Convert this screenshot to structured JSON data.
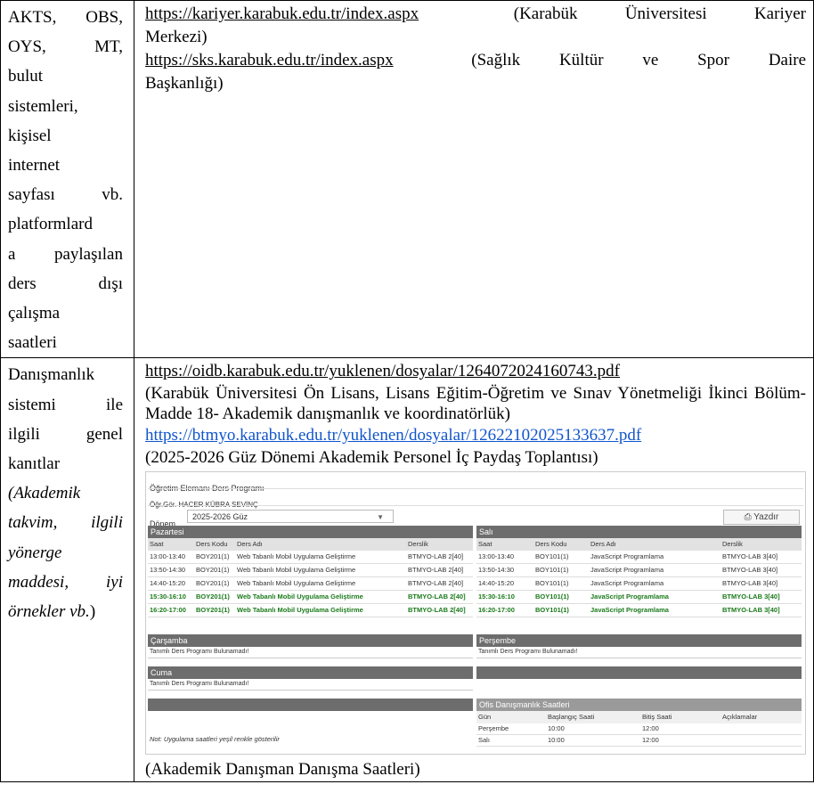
{
  "row1": {
    "left_lines": [
      "AKTS, OBS,",
      "OYS, MT,",
      "bulut",
      "sistemleri,",
      "kişisel",
      "internet",
      "sayfası vb.",
      "platformlard",
      "a paylaşılan",
      "ders dışı",
      "çalışma",
      "saatleri"
    ],
    "links": [
      {
        "url": "https://kariyer.karabuk.edu.tr/index.aspx",
        "desc": "(Karabük Üniversitesi Kariyer Merkezi)"
      },
      {
        "url": "https://sks.karabuk.edu.tr/index.aspx",
        "desc": "(Sağlık Kültür ve Spor Daire Başkanlığı)"
      }
    ]
  },
  "row2": {
    "left_lines": [
      "Danışmanlık",
      "sistemi ile",
      "ilgili genel",
      "kanıtlar"
    ],
    "left_italic_lines": [
      "(Akademik",
      "takvim, ilgili",
      "yönerge",
      "maddesi, iyi"
    ],
    "left_last": {
      "italic": "örnekler vb.",
      "plain": ")"
    },
    "link1": "https://oidb.karabuk.edu.tr/yuklenen/dosyalar/1264072024160743.pdf",
    "link1_desc": "(Karabük Üniversitesi Ön Lisans, Lisans Eğitim-Öğretim ve Sınav Yönetmeliği İkinci Bölüm- Madde 18- Akademik danışmanlık ve koordinatörlük)",
    "link2": "https://btmyo.karabuk.edu.tr/yuklenen/dosyalar/12622102025133637.pdf",
    "link2_desc": "(2025-2026 Güz Dönemi Akademik Personel İç Paydaş Toplantısı)",
    "caption": "(Akademik Danışman Danışma Saatleri)"
  },
  "schedule": {
    "title": "Öğretim Elemanı Ders Programı",
    "instructor": "Öğr.Gör. HACER KÜBRA SEVİNÇ",
    "donem_label": "Dönem",
    "donem_value": "2025-2026 Güz",
    "print_label": "Yazdır",
    "columns": {
      "saat": "Saat",
      "kod": "Ders Kodu",
      "ad": "Ders Adı",
      "derslik": "Derslik"
    },
    "pazartesi": {
      "label": "Pazartesi",
      "rows": [
        {
          "saat": "13:00-13:40",
          "kod": "BOY201(1)",
          "ad": "Web Tabanlı Mobil Uygulama Geliştirme",
          "derslik": "BTMYO-LAB 2[40]"
        },
        {
          "saat": "13:50-14:30",
          "kod": "BOY201(1)",
          "ad": "Web Tabanlı Mobil Uygulama Geliştirme",
          "derslik": "BTMYO-LAB 2[40]"
        },
        {
          "saat": "14:40-15:20",
          "kod": "BOY201(1)",
          "ad": "Web Tabanlı Mobil Uygulama Geliştirme",
          "derslik": "BTMYO-LAB 2[40]"
        },
        {
          "saat": "15:30-16:10",
          "kod": "BOY201(1)",
          "ad": "Web Tabanlı Mobil Uygulama Geliştirme",
          "derslik": "BTMYO-LAB 2[40]"
        },
        {
          "saat": "16:20-17:00",
          "kod": "BOY201(1)",
          "ad": "Web Tabanlı Mobil Uygulama Geliştirme",
          "derslik": "BTMYO-LAB 2[40]"
        }
      ]
    },
    "sali": {
      "label": "Salı",
      "rows": [
        {
          "saat": "13:00-13:40",
          "kod": "BOY101(1)",
          "ad": "JavaScript Programlama",
          "derslik": "BTMYO-LAB 3[40]"
        },
        {
          "saat": "13:50-14:30",
          "kod": "BOY101(1)",
          "ad": "JavaScript Programlama",
          "derslik": "BTMYO-LAB 3[40]"
        },
        {
          "saat": "14:40-15:20",
          "kod": "BOY101(1)",
          "ad": "JavaScript Programlama",
          "derslik": "BTMYO-LAB 3[40]"
        },
        {
          "saat": "15:30-16:10",
          "kod": "BOY101(1)",
          "ad": "JavaScript Programlama",
          "derslik": "BTMYO-LAB 3[40]"
        },
        {
          "saat": "16:20-17:00",
          "kod": "BOY101(1)",
          "ad": "JavaScript Programlama",
          "derslik": "BTMYO-LAB 3[40]"
        }
      ]
    },
    "carsamba": {
      "label": "Çarşamba",
      "empty": "Tanımlı Ders Programı Bulunamadı!"
    },
    "persembe": {
      "label": "Perşembe",
      "empty": "Tanımlı Ders Programı Bulunamadı!"
    },
    "cuma": {
      "label": "Cuma",
      "empty": "Tanımlı Ders Programı Bulunamadı!"
    },
    "ofis": {
      "label": "Ofis Danışmanlık Saatleri",
      "columns": {
        "gun": "Gün",
        "bas": "Başlangıç Saati",
        "bit": "Bitiş Saati",
        "aciklama": "Açıklamalar"
      },
      "rows": [
        {
          "gun": "Perşembe",
          "bas": "10:00",
          "bit": "12:00"
        },
        {
          "gun": "Salı",
          "bas": "10:00",
          "bit": "12:00"
        }
      ]
    },
    "note": "Not: Uygulama saatleri yeşil renkle gösterilir"
  }
}
